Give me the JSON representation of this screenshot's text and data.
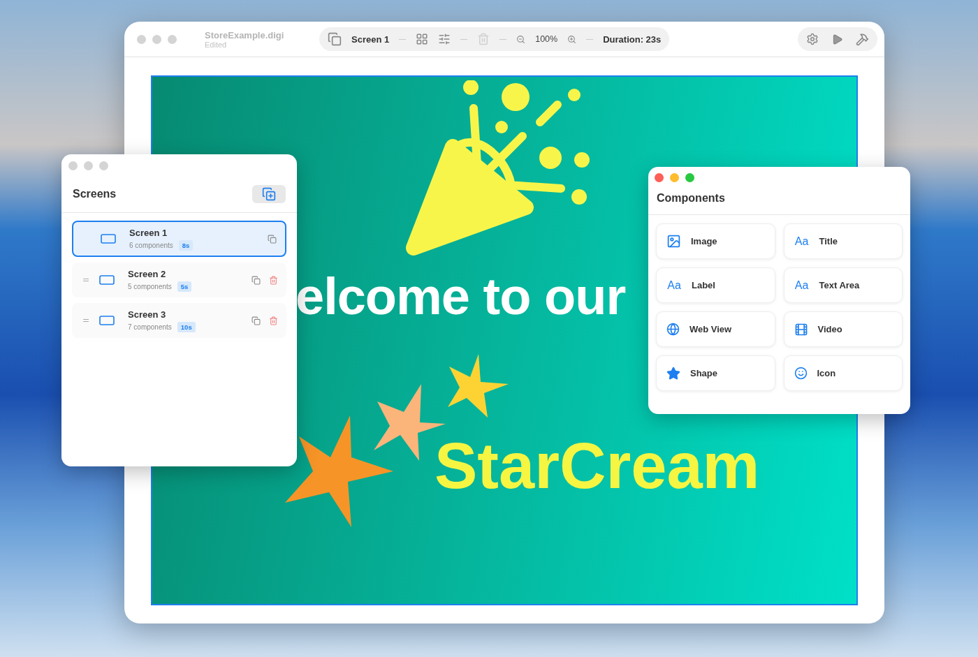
{
  "window": {
    "title": "StoreExample.digi",
    "subtitle": "Edited"
  },
  "toolbar": {
    "screen": "Screen 1",
    "zoom": "100%",
    "duration": "Duration: 23s",
    "delete_disabled": true
  },
  "canvas": {
    "headline": "elcome to our",
    "brand": "StarCream"
  },
  "screens_panel": {
    "title": "Screens",
    "screens": [
      {
        "name": "Screen 1",
        "components": "6 components",
        "duration": "8s",
        "selected": true
      },
      {
        "name": "Screen 2",
        "components": "5 components",
        "duration": "5s",
        "selected": false
      },
      {
        "name": "Screen 3",
        "components": "7 components",
        "duration": "10s",
        "selected": false
      }
    ]
  },
  "components_panel": {
    "title": "Components",
    "items": [
      {
        "kind": "image",
        "label": "Image"
      },
      {
        "kind": "text",
        "glyph": "Aa",
        "label": "Title"
      },
      {
        "kind": "text",
        "glyph": "Aa",
        "label": "Label"
      },
      {
        "kind": "text",
        "glyph": "Aa",
        "label": "Text Area"
      },
      {
        "kind": "web",
        "label": "Web View"
      },
      {
        "kind": "video",
        "label": "Video"
      },
      {
        "kind": "shape",
        "label": "Shape"
      },
      {
        "kind": "icon",
        "label": "Icon"
      }
    ]
  }
}
